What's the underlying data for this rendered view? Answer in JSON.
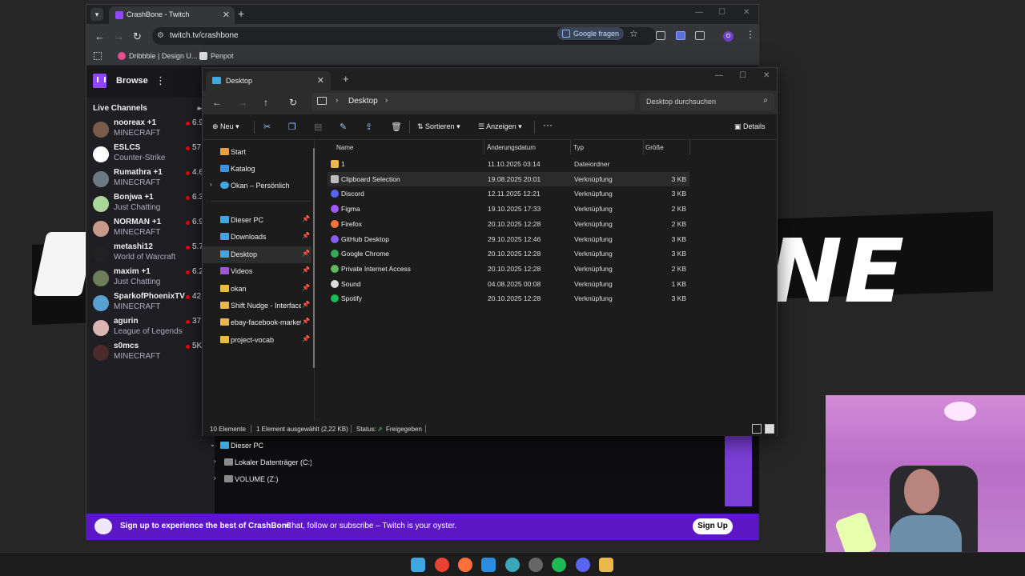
{
  "chrome": {
    "tab_title": "CrashBone - Twitch",
    "url": "twitch.tv/crashbone",
    "google_fragen": "Google fragen",
    "profile_initial": "O",
    "bookmarks": [
      "Dribbble | Design U...",
      "Penpot"
    ]
  },
  "twitch": {
    "browse": "Browse",
    "live_channels_title": "Live Channels",
    "channels": [
      {
        "name": "nooreax +1",
        "game": "MINECRAFT",
        "viewers": "6.9",
        "color": "#7a5a4a"
      },
      {
        "name": "ESLCS",
        "game": "Counter-Strike",
        "viewers": "57",
        "color": "#ffffff"
      },
      {
        "name": "Rumathra +1",
        "game": "MINECRAFT",
        "viewers": "4.6",
        "color": "#6c7a86"
      },
      {
        "name": "Bonjwa +1",
        "game": "Just Chatting",
        "viewers": "6.3",
        "color": "#a9d79a"
      },
      {
        "name": "NORMAN +1",
        "game": "MINECRAFT",
        "viewers": "6.9",
        "color": "#c69a8b"
      },
      {
        "name": "metashi12",
        "game": "World of Warcraft",
        "viewers": "5.7",
        "color": "#222222"
      },
      {
        "name": "maxim +1",
        "game": "Just Chatting",
        "viewers": "6.2",
        "color": "#6d7d5a"
      },
      {
        "name": "SparkofPhoenixTV",
        "game": "MINECRAFT",
        "viewers": "42",
        "color": "#5aa0d0"
      },
      {
        "name": "agurin",
        "game": "League of Legends",
        "viewers": "37",
        "color": "#d9b7b0"
      },
      {
        "name": "s0mcs",
        "game": "MINECRAFT",
        "viewers": "5K",
        "color": "#4a2a2a"
      }
    ],
    "signup_bold": "Sign up to experience the best of CrashBone",
    "signup_text": "Chat, follow or subscribe – Twitch is your oyster.",
    "signup_button": "Sign Up"
  },
  "explorer": {
    "tab_title": "Desktop",
    "path_segment": "Desktop",
    "search_placeholder": "Desktop durchsuchen",
    "commands": {
      "new": "Neu",
      "sort": "Sortieren",
      "view": "Anzeigen",
      "details": "Details"
    },
    "nav": {
      "start": "Start",
      "katalog": "Katalog",
      "onedrive": "Okan – Persönlich",
      "pinned": [
        "Dieser PC",
        "Downloads",
        "Desktop",
        "Videos",
        "okan",
        "Shift Nudge - Interface D",
        "ebay-facebook-market-a",
        "project-vocab"
      ],
      "this_pc": "Dieser PC",
      "drives": [
        "Lokaler Datenträger (C:)",
        "VOLUME (Z:)"
      ]
    },
    "columns": {
      "name": "Name",
      "date": "Änderungsdatum",
      "type": "Typ",
      "size": "Größe"
    },
    "files": [
      {
        "name": "1",
        "date": "11.10.2025 03:14",
        "type": "Dateiordner",
        "size": "",
        "icon": "folder-icon",
        "color": "#e8b84a"
      },
      {
        "name": "Clipboard Selection",
        "date": "19.08.2025 20:01",
        "type": "Verknüpfung",
        "size": "3 KB",
        "icon": "shortcut-icon",
        "color": "#bbbbbb"
      },
      {
        "name": "Discord",
        "date": "12.11.2025 12:21",
        "type": "Verknüpfung",
        "size": "3 KB",
        "icon": "discord-icon",
        "color": "#5865f2"
      },
      {
        "name": "Figma",
        "date": "19.10.2025 17:33",
        "type": "Verknüpfung",
        "size": "2 KB",
        "icon": "figma-icon",
        "color": "#a259ff"
      },
      {
        "name": "Firefox",
        "date": "20.10.2025 12:28",
        "type": "Verknüpfung",
        "size": "2 KB",
        "icon": "firefox-icon",
        "color": "#ff7139"
      },
      {
        "name": "GitHub Desktop",
        "date": "29.10.2025 12:46",
        "type": "Verknüpfung",
        "size": "3 KB",
        "icon": "github-icon",
        "color": "#8a5cf6"
      },
      {
        "name": "Google Chrome",
        "date": "20.10.2025 12:28",
        "type": "Verknüpfung",
        "size": "3 KB",
        "icon": "chrome-icon",
        "color": "#34a853"
      },
      {
        "name": "Private Internet Access",
        "date": "20.10.2025 12:28",
        "type": "Verknüpfung",
        "size": "2 KB",
        "icon": "pia-icon",
        "color": "#5fb85f"
      },
      {
        "name": "Sound",
        "date": "04.08.2025 00:08",
        "type": "Verknüpfung",
        "size": "1 KB",
        "icon": "sound-icon",
        "color": "#dddddd"
      },
      {
        "name": "Spotify",
        "date": "20.10.2025 12:28",
        "type": "Verknüpfung",
        "size": "3 KB",
        "icon": "spotify-icon",
        "color": "#1db954"
      }
    ],
    "status": {
      "count": "10 Elemente",
      "selected": "1 Element ausgewählt (2,22 KB)",
      "status_label": "Status:",
      "status_value": "Freigegeben"
    }
  },
  "background": {
    "word": "NE"
  }
}
